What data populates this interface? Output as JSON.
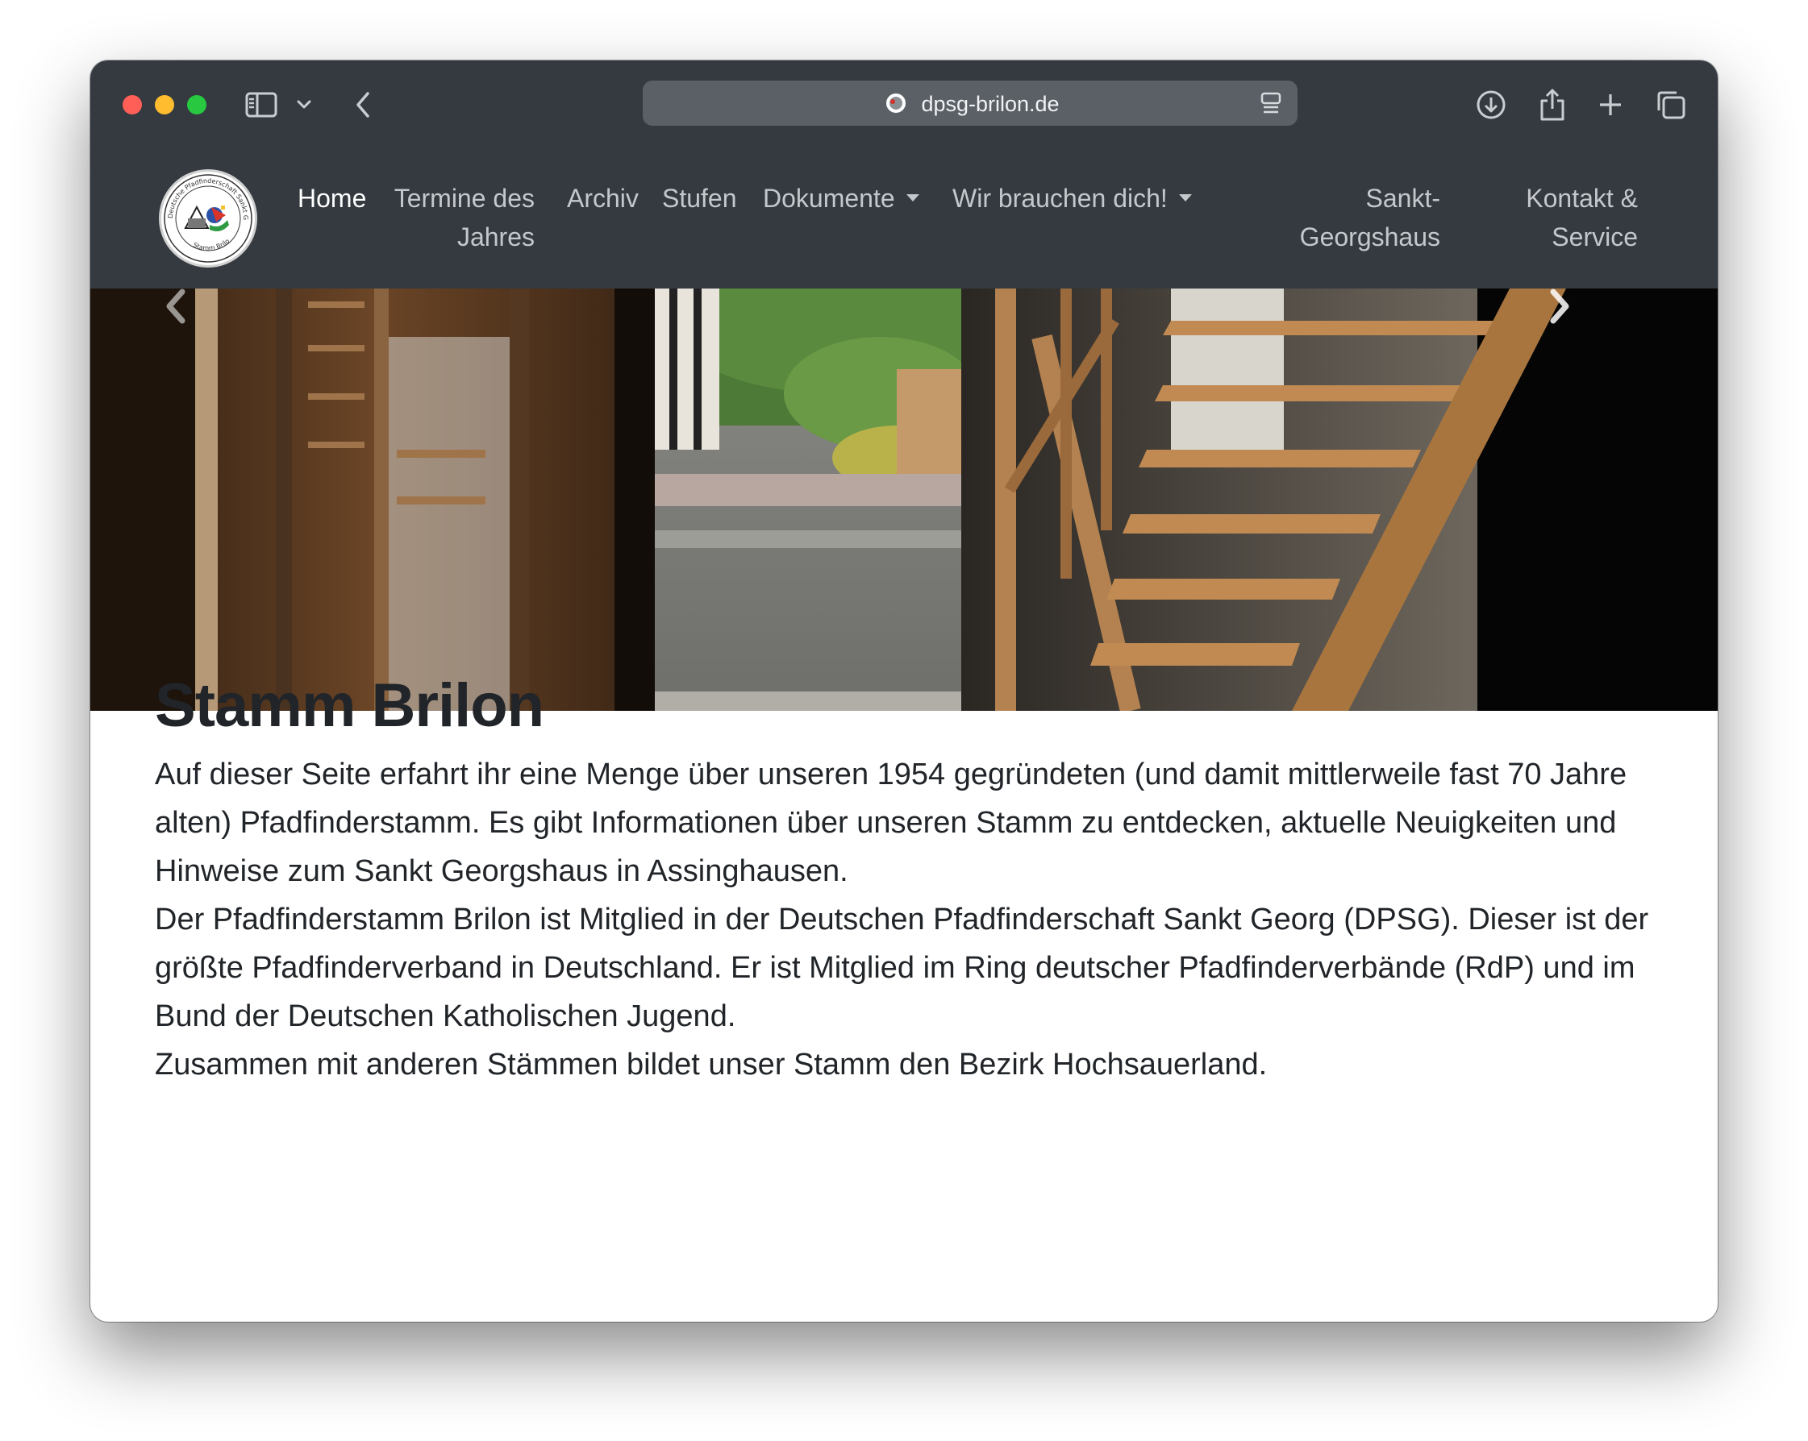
{
  "browser": {
    "url": "dpsg-brilon.de"
  },
  "navbar": {
    "logo_text_top": "Deutsche Pfadfinderschaft Sankt Georg",
    "logo_text_bottom": "Stamm Brilon",
    "items": [
      {
        "line1": "Home",
        "line2": ""
      },
      {
        "line1": "Termine des",
        "line2": "Jahres"
      },
      {
        "line1": "Archiv",
        "line2": ""
      },
      {
        "line1": "Stufen",
        "line2": ""
      },
      {
        "line1": "Dokumente",
        "line2": ""
      },
      {
        "line1": "Wir brauchen dich!",
        "line2": ""
      },
      {
        "line1": "Sankt-",
        "line2": "Georgshaus"
      },
      {
        "line1": "Kontakt &",
        "line2": "Service"
      }
    ]
  },
  "main": {
    "title": "Stamm Brilon",
    "paragraphs": [
      "Auf dieser Seite erfahrt ihr eine Menge über unseren 1954 gegründeten (und damit mittlerweile fast 70 Jahre alten) Pfadfinderstamm. Es gibt Informationen über unseren Stamm zu entdecken, aktuelle Neuigkeiten und Hinweise zum Sankt Georgshaus in Assinghausen.",
      "Der Pfadfinderstamm Brilon ist Mitglied in der Deutschen Pfadfinderschaft Sankt Georg (DPSG). Dieser ist der größte Pfadfinderverband in Deutschland. Er ist Mitglied im Ring deutscher Pfadfinderverbände (RdP) und im Bund der Deutschen Katholischen Jugend.",
      "Zusammen mit anderen Stämmen bildet unser Stamm den Bezirk Hochsauerland."
    ]
  },
  "colors": {
    "navbar_bg": "#343a40",
    "nav_active": "#ffffff",
    "nav_inactive": "#c4c8cc",
    "text": "#212529"
  }
}
